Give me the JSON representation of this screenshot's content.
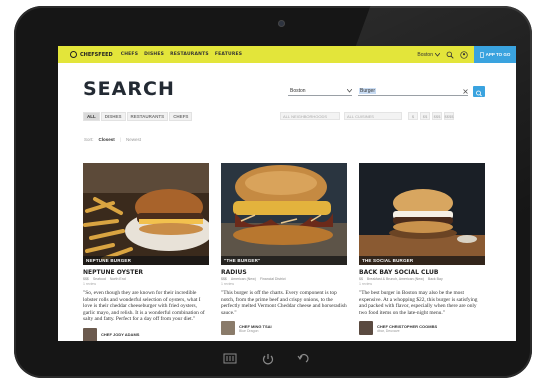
{
  "nav": {
    "logo": "CHEFSFEED",
    "links": [
      "CHEFS",
      "DISHES",
      "RESTAURANTS",
      "FEATURES"
    ],
    "city": "Boston",
    "app_button": "APP TO GO"
  },
  "search": {
    "title": "SEARCH",
    "location_value": "Boston",
    "query_value": "Burger"
  },
  "filters": {
    "tabs": [
      "ALL",
      "DISHES",
      "RESTAURANTS",
      "CHEFS"
    ],
    "dropdown_1": "ALL NEIGHBORHOODS",
    "dropdown_2": "ALL CUISINES",
    "prices": [
      "$",
      "$$",
      "$$$",
      "$$$$"
    ]
  },
  "sort": {
    "label": "Sort:",
    "options": [
      "Closest",
      "Newest"
    ]
  },
  "cards": [
    {
      "caption": "NEPTUNE BURGER",
      "name": "NEPTUNE OYSTER",
      "tags": [
        "$$$",
        "Seafood",
        "North End"
      ],
      "sub": "1 review",
      "text": "\"So, even though they are known for their incredible lobster rolls and wonderful selection of oysters, what I love is their cheddar cheeseburger with fried oysters, garlic mayo, and relish. It is a wonderful combination of salty and fatty. Perfect for a day off from your diet.\"",
      "author": "CHEF JODY ADAMS",
      "author_sub": ""
    },
    {
      "caption": "\"THE BURGER\"",
      "name": "RADIUS",
      "tags": [
        "$$$",
        "American (New)",
        "Financial District"
      ],
      "sub": "1 review",
      "text": "\"This burger is off the charts. Every component is top notch, from the prime beef and crispy onions, to the perfectly melted Vermont Cheddar cheese and horseradish sauce.\"",
      "author": "CHEF MING TSAI",
      "author_sub": "Blue Dragon"
    },
    {
      "caption": "THE SOCIAL BURGER",
      "name": "BACK BAY SOCIAL CLUB",
      "tags": [
        "$$",
        "Breakfast & Brunch, American (New)",
        "Back Bay"
      ],
      "sub": "1 review",
      "text": "\"The best burger in Boston may also be the most expensive. At a whopping $22, this burger is satisfying and packed with flavor, especially when there are only two food items on the late-night menu.\"",
      "author": "CHEF CHRISTOPHER COOMBS",
      "author_sub": "dbar, Deuxave"
    }
  ],
  "colors": {
    "nav_yellow": "#e3e53a",
    "accent_blue": "#3aa3df",
    "title_dark": "#232a33"
  }
}
